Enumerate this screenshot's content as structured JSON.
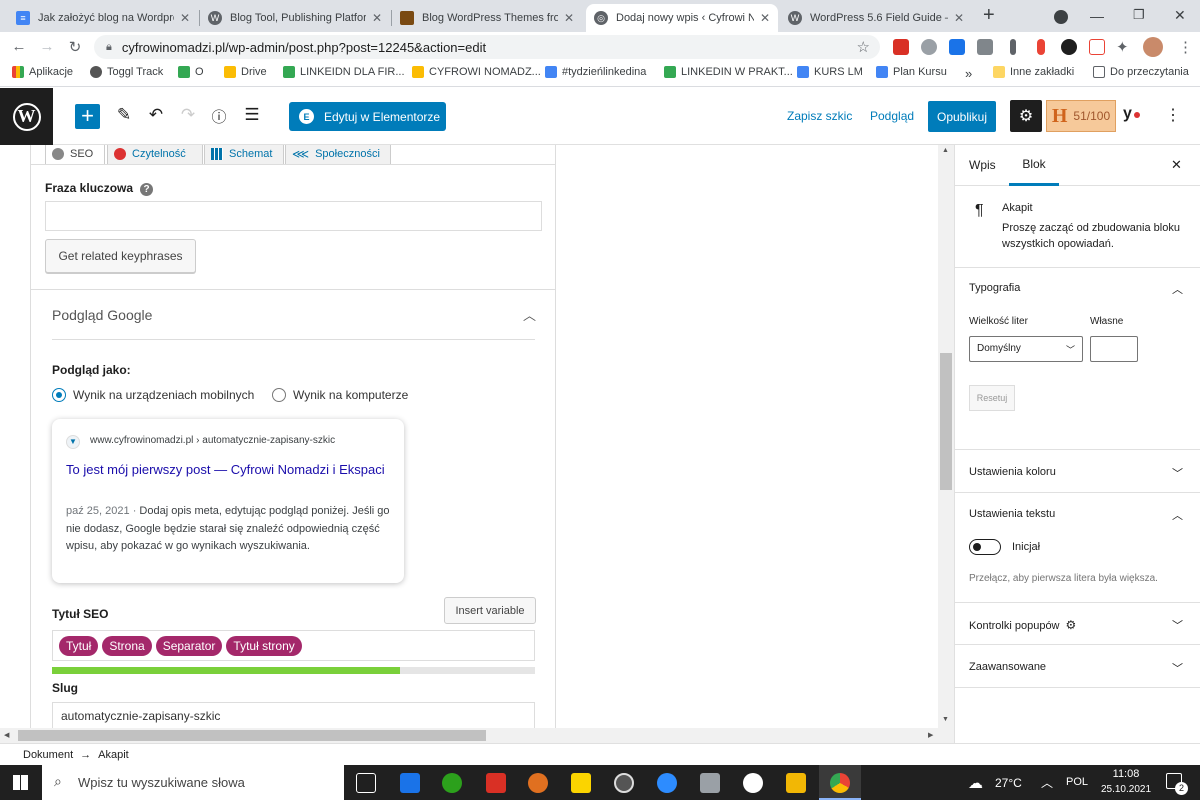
{
  "browser": {
    "tabs": [
      {
        "label": "Jak założyć blog na Wordpress",
        "color": "#4285f4",
        "active": false
      },
      {
        "label": "Blog Tool, Publishing Platform",
        "color": "#3c4043",
        "active": false
      },
      {
        "label": "Blog WordPress Themes from",
        "color": "#7a4a12",
        "active": false
      },
      {
        "label": "Dodaj nowy wpis ‹ Cyfrowi N",
        "color": "#5f6368",
        "active": true
      },
      {
        "label": "WordPress 5.6 Field Guide – M",
        "color": "#3c4043",
        "active": false
      }
    ],
    "new_tab": "+",
    "url": "cyfrowinomadzi.pl/wp-admin/post.php?post=12245&action=edit",
    "bookmarks": [
      {
        "label": "Aplikacje",
        "color": "#ea4335"
      },
      {
        "label": "Toggl Track",
        "color": "#555555"
      },
      {
        "label": "O",
        "color": "#34a853"
      },
      {
        "label": "Drive",
        "color": "#fbbc04"
      },
      {
        "label": "LINKEIDN DLA FIR...",
        "color": "#34a853"
      },
      {
        "label": "CYFROWI NOMADZ...",
        "color": "#fbbc04"
      },
      {
        "label": "#tydzieńlinkedina",
        "color": "#4285f4"
      },
      {
        "label": "LINKEDIN W PRAKT...",
        "color": "#34a853"
      },
      {
        "label": "KURS LM",
        "color": "#4285f4"
      },
      {
        "label": "Plan Kursu",
        "color": "#4285f4"
      }
    ],
    "bookmarks_more": "»",
    "other_bookmarks": "Inne zakładki",
    "reading_list": "Do przeczytania"
  },
  "toolbar": {
    "elementor_label": "Edytuj w Elementorze",
    "save_draft": "Zapisz szkic",
    "preview": "Podgląd",
    "publish": "Opublikuj",
    "score": "51/100"
  },
  "yoast": {
    "tabs": [
      "SEO",
      "Czytelność",
      "Schemat",
      "Społeczności"
    ],
    "keyphrase_label": "Fraza kluczowa",
    "related_button": "Get related keyphrases",
    "google_preview_title": "Podgląd Google",
    "preview_as": "Podgląd jako:",
    "mobile_option": "Wynik na urządzeniach mobilnych",
    "desktop_option": "Wynik na komputerze",
    "serp": {
      "breadcrumb": "www.cyfrowinomadzi.pl › automatycznie-zapisany-szkic",
      "title": "To jest mój pierwszy post — Cyfrowi Nomadzi i Ekspaci",
      "date": "paź 25, 2021",
      "separator": "·",
      "description": "Dodaj opis meta, edytując podgląd poniżej. Jeśli go nie dodasz, Google będzie starał się znaleźć odpowiednią część wpisu, aby pokazać w go wynikach wyszukiwania."
    },
    "seo_title_label": "Tytuł SEO",
    "insert_variable": "Insert variable",
    "title_pills": [
      "Tytuł",
      "Strona",
      "Separator",
      "Tytuł strony"
    ],
    "title_progress": 0.72,
    "slug_label": "Slug",
    "slug_value": "automatycznie-zapisany-szkic"
  },
  "sidebar": {
    "tabs": [
      "Wpis",
      "Blok"
    ],
    "block_name": "Akapit",
    "block_desc": "Proszę zacząć od zbudowania bloku wszystkich opowiadań.",
    "typography": "Typografia",
    "font_size_label": "Wielkość liter",
    "custom_label": "Własne",
    "font_size_value": "Domyślny",
    "reset": "Resetuj",
    "color_settings": "Ustawienia koloru",
    "text_settings": "Ustawienia tekstu",
    "drop_cap": "Inicjał",
    "drop_cap_help": "Przełącz, aby pierwsza litera była większa.",
    "popup_controls": "Kontrolki popupów",
    "advanced": "Zaawansowane"
  },
  "breadcrumb": {
    "root": "Dokument",
    "arrow": "→",
    "current": "Akapit"
  },
  "taskbar": {
    "search_placeholder": "Wpisz tu wyszukiwane słowa",
    "temperature": "27°C",
    "language": "POL",
    "time": "11:08",
    "date": "25.10.2021",
    "notifications": "2"
  }
}
